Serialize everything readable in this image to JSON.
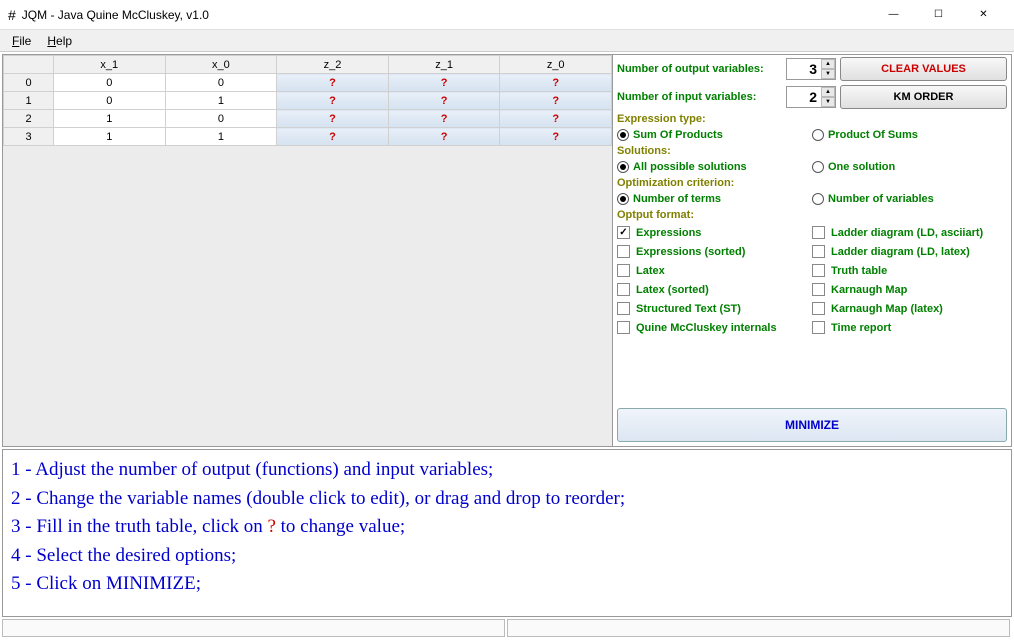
{
  "window": {
    "title": "JQM - Java Quine McCluskey, v1.0",
    "icon": "#"
  },
  "menu": {
    "file": "File",
    "help": "Help"
  },
  "truthtable": {
    "input_headers": [
      "x_1",
      "x_0"
    ],
    "output_headers": [
      "z_2",
      "z_1",
      "z_0"
    ],
    "rows": [
      {
        "idx": "0",
        "inputs": [
          "0",
          "0"
        ],
        "outputs": [
          "?",
          "?",
          "?"
        ]
      },
      {
        "idx": "1",
        "inputs": [
          "0",
          "1"
        ],
        "outputs": [
          "?",
          "?",
          "?"
        ]
      },
      {
        "idx": "2",
        "inputs": [
          "1",
          "0"
        ],
        "outputs": [
          "?",
          "?",
          "?"
        ]
      },
      {
        "idx": "3",
        "inputs": [
          "1",
          "1"
        ],
        "outputs": [
          "?",
          "?",
          "?"
        ]
      }
    ]
  },
  "controls": {
    "num_output_label": "Number of output variables:",
    "num_output_value": "3",
    "clear_values": "CLEAR VALUES",
    "num_input_label": "Number of input variables:",
    "num_input_value": "2",
    "km_order": "KM ORDER",
    "expr_type_label": "Expression type:",
    "sop": "Sum Of Products",
    "pos": "Product Of Sums",
    "solutions_label": "Solutions:",
    "all_sol": "All possible solutions",
    "one_sol": "One solution",
    "opt_crit_label": "Optimization criterion:",
    "num_terms": "Number of terms",
    "num_vars": "Number of variables",
    "output_fmt_label": "Optput format:",
    "fmt_expressions": "Expressions",
    "fmt_ladder_ascii": "Ladder diagram (LD, asciiart)",
    "fmt_expr_sorted": "Expressions (sorted)",
    "fmt_ladder_latex": "Ladder diagram (LD, latex)",
    "fmt_latex": "Latex",
    "fmt_truth_table": "Truth table",
    "fmt_latex_sorted": "Latex (sorted)",
    "fmt_kmap": "Karnaugh Map",
    "fmt_st": "Structured Text (ST)",
    "fmt_kmap_latex": "Karnaugh Map (latex)",
    "fmt_qm_internals": "Quine McCluskey internals",
    "fmt_time_report": "Time report",
    "minimize": "MINIMIZE"
  },
  "instructions": {
    "l1a": "1 - Adjust the number of output (functions) and input variables;",
    "l2": "2 - Change the variable names (double click to edit), or drag and drop to reorder;",
    "l3a": "3 - Fill in the truth table, click on ",
    "l3q": "?",
    "l3b": " to change value;",
    "l4": "4 - Select the desired options;",
    "l5": "5 - Click on MINIMIZE;"
  }
}
